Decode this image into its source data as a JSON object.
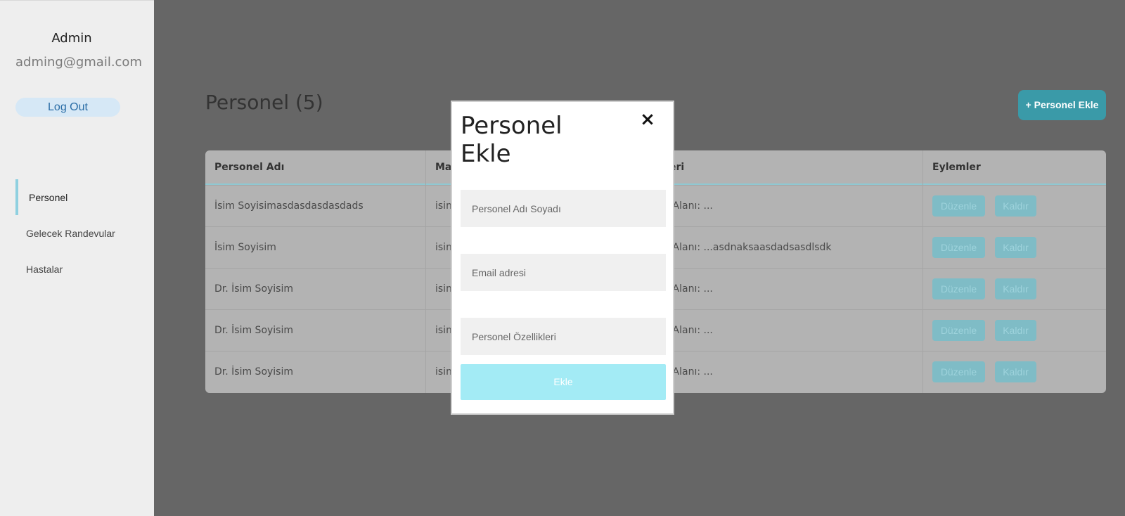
{
  "sidebar": {
    "user_name": "Admin",
    "user_email": "adming@gmail.com",
    "logout_label": "Log Out",
    "nav": [
      {
        "label": "Personel",
        "active": true
      },
      {
        "label": "Gelecek Randevular",
        "active": false
      },
      {
        "label": "Hastalar",
        "active": false
      }
    ]
  },
  "main": {
    "title": "Personel (5)",
    "add_button_label": "+ Personel Ekle",
    "table": {
      "headers": [
        "Personel Adı",
        "Ma",
        "eri",
        "Eylemler"
      ],
      "rows": [
        {
          "name": "İsim Soyisimasdasdasdasdads",
          "col2": "isim",
          "col3": "k Alanı: ..."
        },
        {
          "name": "İsim Soyisim",
          "col2": "isim",
          "col3": "k Alanı: ...asdnaksaasdadsasdlsdk"
        },
        {
          "name": "Dr. İsim Soyisim",
          "col2": "isim",
          "col3": "k Alanı: ..."
        },
        {
          "name": "Dr. İsim Soyisim",
          "col2": "isim",
          "col3": "k Alanı: ..."
        },
        {
          "name": "Dr. İsim Soyisim",
          "col2": "isim",
          "col3": "k Alanı: ..."
        }
      ],
      "edit_label": "Düzenle",
      "remove_label": "Kaldır"
    }
  },
  "modal": {
    "title": "Personel Ekle",
    "close_icon": "×",
    "name_placeholder": "Personel Adı Soyadı",
    "email_placeholder": "Email adresi",
    "features_placeholder": "Personel Özellikleri",
    "submit_label": "Ekle"
  },
  "colors": {
    "overlay": "#666666",
    "accent": "#3a9aa8",
    "nav_active_bar": "#8fd0e0",
    "submit_disabled": "#a3ebf5"
  }
}
